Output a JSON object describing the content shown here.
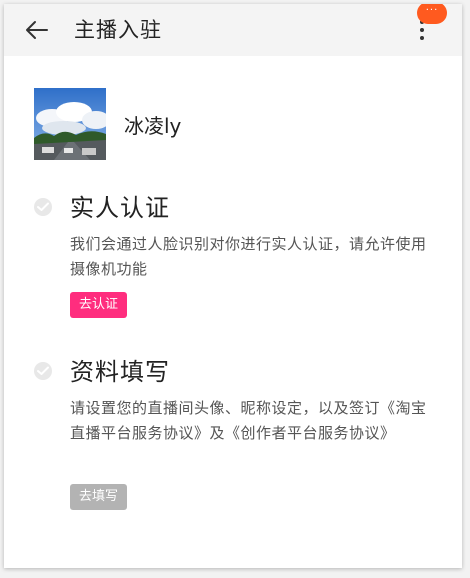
{
  "header": {
    "title": "主播入驻",
    "notification_badge": "···"
  },
  "profile": {
    "username": "冰凌ly"
  },
  "steps": [
    {
      "title": "实人认证",
      "description": "我们会通过人脸识别对你进行实人认证，请允许使用摄像机功能",
      "button_label": "去认证",
      "button_color": "#ff2d7e"
    },
    {
      "title": "资料填写",
      "description": "请设置您的直播间头像、昵称设定，以及签订《淘宝直播平台服务协议》及《创作者平台服务协议》",
      "button_label": "去填写",
      "button_color": "#b3b3b3"
    }
  ]
}
